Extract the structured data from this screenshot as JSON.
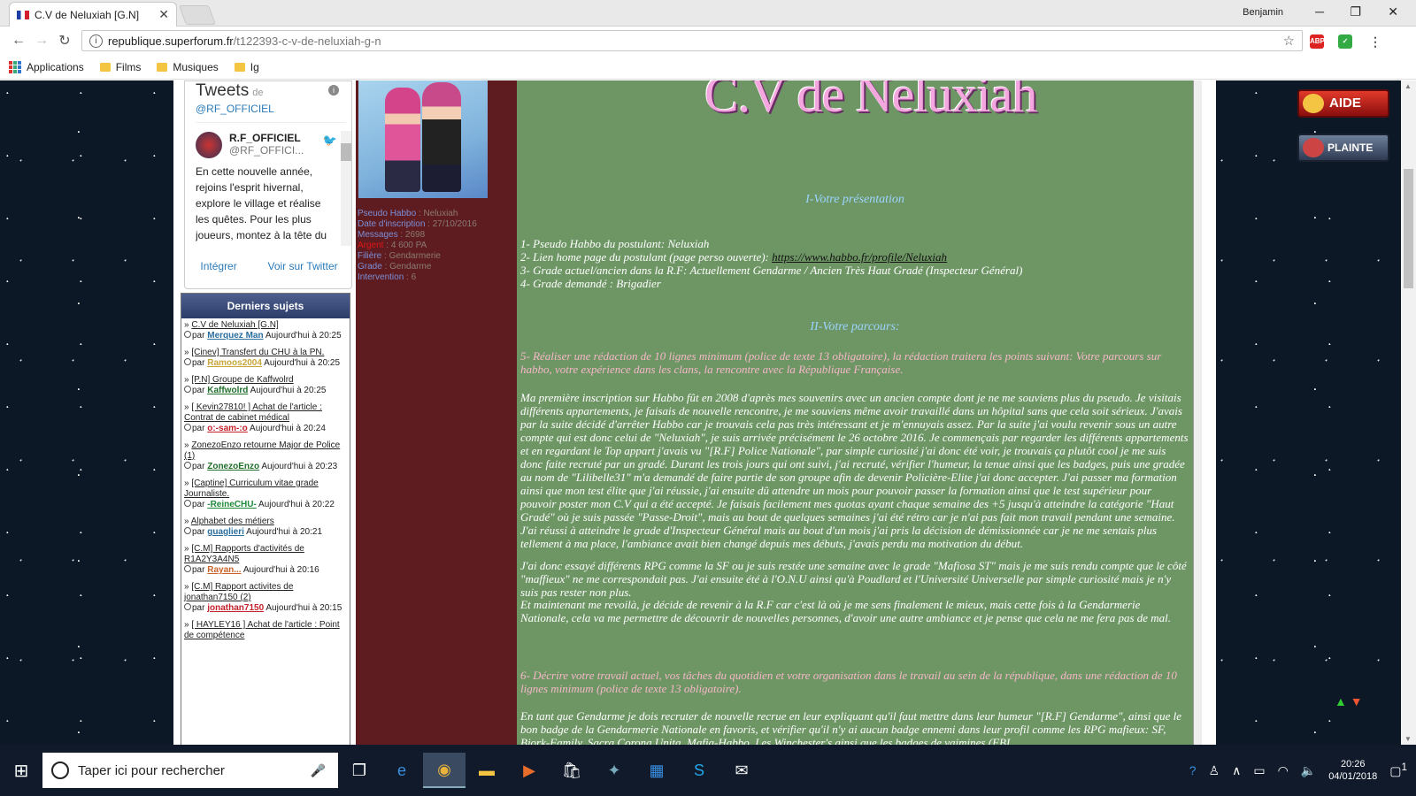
{
  "browser": {
    "tab_title": "C.V de Neluxiah [G.N]",
    "user": "Benjamin",
    "url_host": "republique.superforum.fr",
    "url_path": "/t122393-c-v-de-neluxiah-g-n",
    "bookmarks": [
      "Applications",
      "Films",
      "Musiques",
      "Ig"
    ]
  },
  "twitter": {
    "title": "Tweets",
    "de": "de",
    "handle": "@RF_OFFICIEL",
    "name": "R.F_OFFICIEL",
    "at": "@RF_OFFICI...",
    "text": "En cette nouvelle année, rejoins l'esprit hivernal, explore le village et réalise les quêtes. Pour les plus joueurs, montez à la tête du",
    "embed": "Intégrer",
    "view": "Voir sur Twitter"
  },
  "derniers": {
    "title": "Derniers sujets",
    "items": [
      {
        "topic": "C.V de Neluxiah [G.N]",
        "user": "Merquez Man",
        "user_color": "#2a6e9e",
        "when": "Aujourd'hui à 20:25"
      },
      {
        "topic": "[Cinev] Transfert du CHU à la PN.",
        "user": "Ramoos2004",
        "user_color": "#c8a63a",
        "when": "Aujourd'hui à 20:25"
      },
      {
        "topic": "[P.N] Groupe de Kaffwolrd",
        "user": "Kaffwolrd",
        "user_color": "#1f6e2a",
        "when": "Aujourd'hui à 20:25"
      },
      {
        "topic": "[ Kevin27810! ] Achat de l'article : Contrat de cabinet médical",
        "user": "o:-sam-:o",
        "user_color": "#c4222a",
        "when": "Aujourd'hui à 20:24"
      },
      {
        "topic": "ZonezoEnzo retourne Major de Police (1)",
        "user": "ZonezoEnzo",
        "user_color": "#1f6e2a",
        "when": "Aujourd'hui à 20:23"
      },
      {
        "topic": "[Captine] Curriculum vitae grade Journaliste.",
        "user": "-ReineCHU-",
        "user_color": "#1f8a3a",
        "when": "Aujourd'hui à 20:22"
      },
      {
        "topic": "Alphabet des métiers",
        "user": "guaglieri",
        "user_color": "#2a6e9e",
        "when": "Aujourd'hui à 20:21"
      },
      {
        "topic": "[C.M] Rapports d'activités de R1A2Y3A4N5",
        "user": "Rayan...",
        "user_color": "#c8632a",
        "when": "Aujourd'hui à 20:16"
      },
      {
        "topic": "[C.M] Rapport activites de jonathan7150 (2)",
        "user": "jonathan7150",
        "user_color": "#c4222a",
        "when": "Aujourd'hui à 20:15"
      },
      {
        "topic": "[ HAYLEY16 ] Achat de l'article : Point de compétence",
        "user": "",
        "user_color": "#222",
        "when": ""
      }
    ],
    "par": "par"
  },
  "profile": {
    "fields": [
      {
        "k": "Pseudo Habbo",
        "v": "Neluxiah",
        "red": false
      },
      {
        "k": "Date d'inscription",
        "v": "27/10/2016",
        "red": false
      },
      {
        "k": "Messages",
        "v": "2698",
        "red": false
      },
      {
        "k": "Argent",
        "v": "4 600 PA",
        "red": true
      },
      {
        "k": "Filière",
        "v": "Gendarmerie",
        "red": false
      },
      {
        "k": "Grade",
        "v": "Gendarme",
        "red": false
      },
      {
        "k": "Intervention",
        "v": "6",
        "red": false
      }
    ]
  },
  "post": {
    "title": "C.V de Neluxiah",
    "sec1": "I-Votre présentation",
    "l1": "1- Pseudo Habbo du postulant: Neluxiah",
    "l2a": "2- Lien home page du postulant (page perso ouverte): ",
    "l2link": "https://www.habbo.fr/profile/Neluxiah",
    "l3": "3- Grade actuel/ancien dans la R.F: Actuellement Gendarme / Ancien Très Haut Gradé (Inspecteur Général)",
    "l4": "4- Grade demandé : Brigadier",
    "sec2": "II-Votre parcours:",
    "q5": "5- Réaliser une rédaction de 10 lignes minimum (police de texte 13 obligatoire), la rédaction traitera les points suivant: Votre parcours sur habbo, votre expérience dans les clans, la rencontre avec la République Française.",
    "p1": "Ma première inscription sur Habbo fût en 2008 d'après mes souvenirs avec un ancien compte dont je ne me souviens plus du pseudo. Je visitais différents appartements, je faisais de nouvelle rencontre, je me souviens même avoir travaillé dans un hôpital sans que cela soit sérieux. J'avais par la suite décidé d'arrêter Habbo car je trouvais cela pas très intéressant et je m'ennuyais assez. Par la suite j'ai voulu revenir sous un autre compte qui est donc celui de \"Neluxiah\", je suis arrivée précisément le 26 octobre 2016. Je commençais par regarder les différents appartements et en regardant le Top appart j'avais vu \"[R.F] Police Nationale\", par simple curiosité j'ai donc été voir, je trouvais ça plutôt cool je me suis donc faite recruté par un gradé. Durant les trois jours qui ont suivi, j'ai recruté, vérifier l'humeur, la tenue ainsi que les badges, puis une gradée au nom de \"Lilibelle31\" m'a demandé de faire partie de son groupe afin de devenir Policière-Elite j'ai donc accepter. J'ai passer ma formation ainsi que mon test élite que j'ai réussie, j'ai ensuite dû attendre un mois pour pouvoir passer la formation ainsi que le test supérieur pour pouvoir poster mon C.V qui a été accepté. Je faisais facilement mes quotas ayant chaque semaine des +5 jusqu'à atteindre la catégorie \"Haut Gradé\" où je suis passée \"Passe-Droit\", mais au bout de quelques semaines j'ai été rétro car je n'ai pas fait mon travail pendant une semaine. J'ai réussi à atteindre le grade d'Inspecteur Général mais au bout d'un mois j'ai pris la décision de démissionnée car je ne me sentais plus tellement à ma place, l'ambiance avait bien changé depuis mes débuts, j'avais perdu ma motivation du début.",
    "p2": "J'ai donc essayé différents RPG comme la SF ou je suis restée une semaine avec le grade \"Mafiosa ST\" mais je me suis rendu compte que le côté \"maffieux\" ne me correspondait pas. J'ai ensuite été à l'O.N.U ainsi qu'à Poudlard et l'Université Universelle par simple curiosité mais je n'y suis pas rester non plus.",
    "p3": "Et maintenant me revoilà, je décide de revenir à la R.F car c'est là où je me sens finalement le mieux, mais cette fois à la Gendarmerie Nationale, cela va me permettre de découvrir de nouvelles personnes, d'avoir une autre ambiance et je pense que cela ne me fera pas de mal.",
    "q6": "6- Décrire votre travail actuel, vos tâches du quotidien et votre organisation dans le travail au sein de la république, dans une rédaction de 10 lignes minimum (police de texte 13 obligatoire).",
    "p4": "En tant que Gendarme je dois recruter de nouvelle recrue en leur expliquant qu'il faut mettre dans leur humeur \"[R.F] Gendarme\", ainsi que le bon badge de la Gendarmerie Nationale en favoris, et vérifier qu'il n'y ai aucun badge ennemi dans leur profil comme les RPG mafieux: SF, Bjork-Family, Sacra Corona Unita, Mafia-Habbo, Les Winchester's ainsi que les badges de vaimines (FBI,"
  },
  "buttons": {
    "aide": "AIDE",
    "plainte": "PLAINTE"
  },
  "taskbar": {
    "search": "Taper ici pour rechercher",
    "time": "20:26",
    "date": "04/01/2018",
    "notif": "1"
  }
}
